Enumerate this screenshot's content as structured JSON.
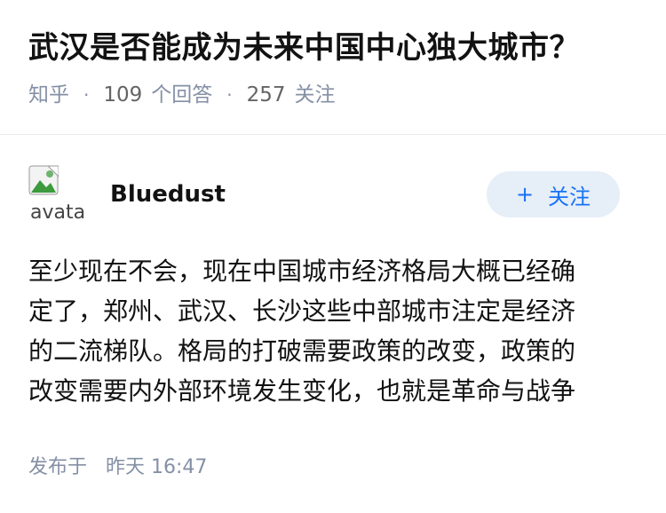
{
  "question": {
    "title": "武汉是否能成为未来中国中心独大城市？",
    "source": "知乎",
    "answer_count": "109",
    "answer_label": "个回答",
    "follower_count": "257",
    "follower_label": "关注"
  },
  "author": {
    "name": "Bluedust",
    "avatar_alt": "avatar",
    "follow_button_label": "关注"
  },
  "answer": {
    "lines": [
      "至少现在不会，现在中国城市经济格局大概已经确",
      "定了，郑州、武汉、长沙这些中部城市注定是经济",
      "的二流梯队。格局的打破需要政策的改变，政策的",
      "改变需要内外部环境发生变化，也就是革命与战争"
    ],
    "published_label": "发布于",
    "published_time": "昨天 16:47"
  },
  "colors": {
    "title": "#121212",
    "meta": "#8590a6",
    "follow_bg": "#e6eef8",
    "follow_text": "#1772f6"
  },
  "icons": {
    "avatar": "broken-image-icon",
    "follow": "plus-icon"
  }
}
